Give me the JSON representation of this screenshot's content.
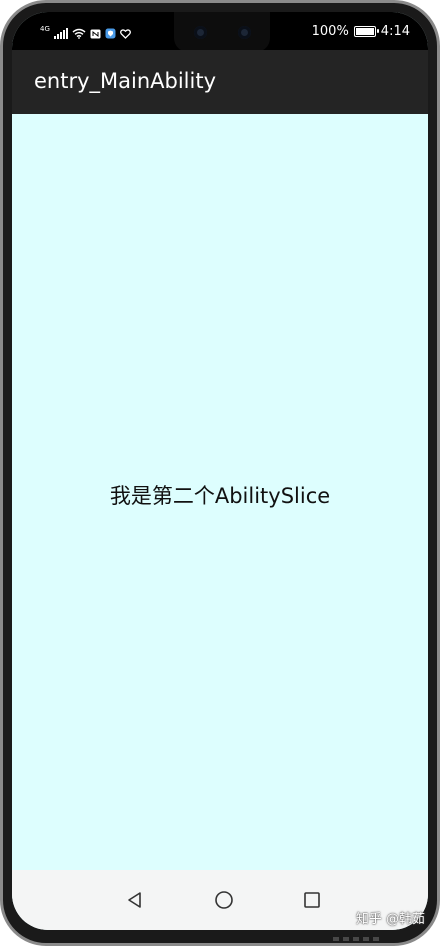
{
  "status_bar": {
    "signal_label": "4G",
    "battery_text": "100%",
    "battery_level_percent": 100,
    "time": "4:14",
    "icons": [
      "signal-icon",
      "wifi-icon",
      "nfc-icon",
      "shield-icon",
      "heart-icon",
      "battery-charging-icon"
    ]
  },
  "app_bar": {
    "title": "entry_MainAbility",
    "background": "#242424"
  },
  "main": {
    "message": "我是第二个AbilitySlice",
    "background": "#ddfefe"
  },
  "nav_bar": {
    "buttons": [
      "back-icon",
      "home-icon",
      "recent-apps-icon"
    ]
  },
  "watermark": {
    "text": "知乎 @韩茹"
  }
}
